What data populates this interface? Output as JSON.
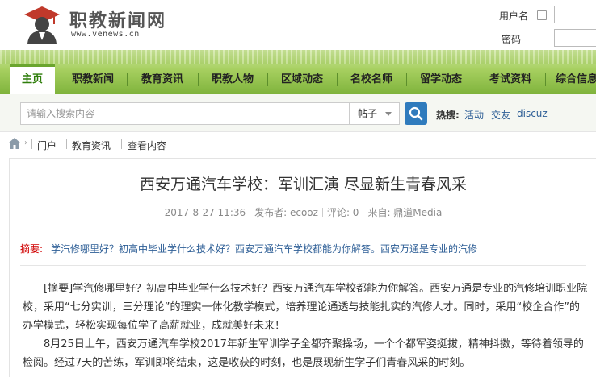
{
  "site": {
    "name": "职教新闻网",
    "url": "www.venews.cn"
  },
  "login": {
    "username_label": "用户名",
    "password_label": "密码"
  },
  "nav": {
    "items": [
      "主页",
      "职教新闻",
      "教育资讯",
      "职教人物",
      "区域动态",
      "名校名师",
      "留学动态",
      "考试资料",
      "综合信息"
    ]
  },
  "search": {
    "placeholder": "请输入搜索内容",
    "scope": "帖子",
    "hot_label": "热搜:",
    "hot_links": [
      "活动",
      "交友",
      "discuz"
    ]
  },
  "breadcrumb": [
    "门户",
    "教育资讯",
    "查看内容"
  ],
  "article": {
    "title": "西安万通汽车学校：军训汇演 尽显新生青春风采",
    "date": "2017-8-27 11:36",
    "author": "发布者: ecooz",
    "comments": "评论: 0",
    "source": "来自: 鼎道Media",
    "summary_label": "摘要:",
    "summary": "学汽修哪里好？初高中毕业学什么技术好？西安万通汽车学校都能为你解答。西安万通是专业的汽修",
    "paragraph1": "[摘要]学汽修哪里好？初高中毕业学什么技术好？西安万通汽车学校都能为你解答。西安万通是专业的汽修培训职业院校，采用“七分实训，三分理论”的理实一体化教学模式，培养理论通透与技能扎实的汽修人才。同时，采用“校企合作”的办学模式，轻松实现每位学子高薪就业，成就美好未来！",
    "paragraph2": "8月25日上午，西安万通汽车学校2017年新生军训学子全都齐聚操场，一个个都军姿挺拔，精神抖擞，等待着领导的检阅。经过7天的苦练，军训即将结束，这是收获的时刻，也是展现新生学子们青春风采的时刻。"
  },
  "colors": {
    "nav_green": "#7fb33c",
    "active_text": "#2e7d0a",
    "link_blue": "#2d5e96",
    "summary_red": "#d00000",
    "search_button": "#2f7bbd"
  }
}
